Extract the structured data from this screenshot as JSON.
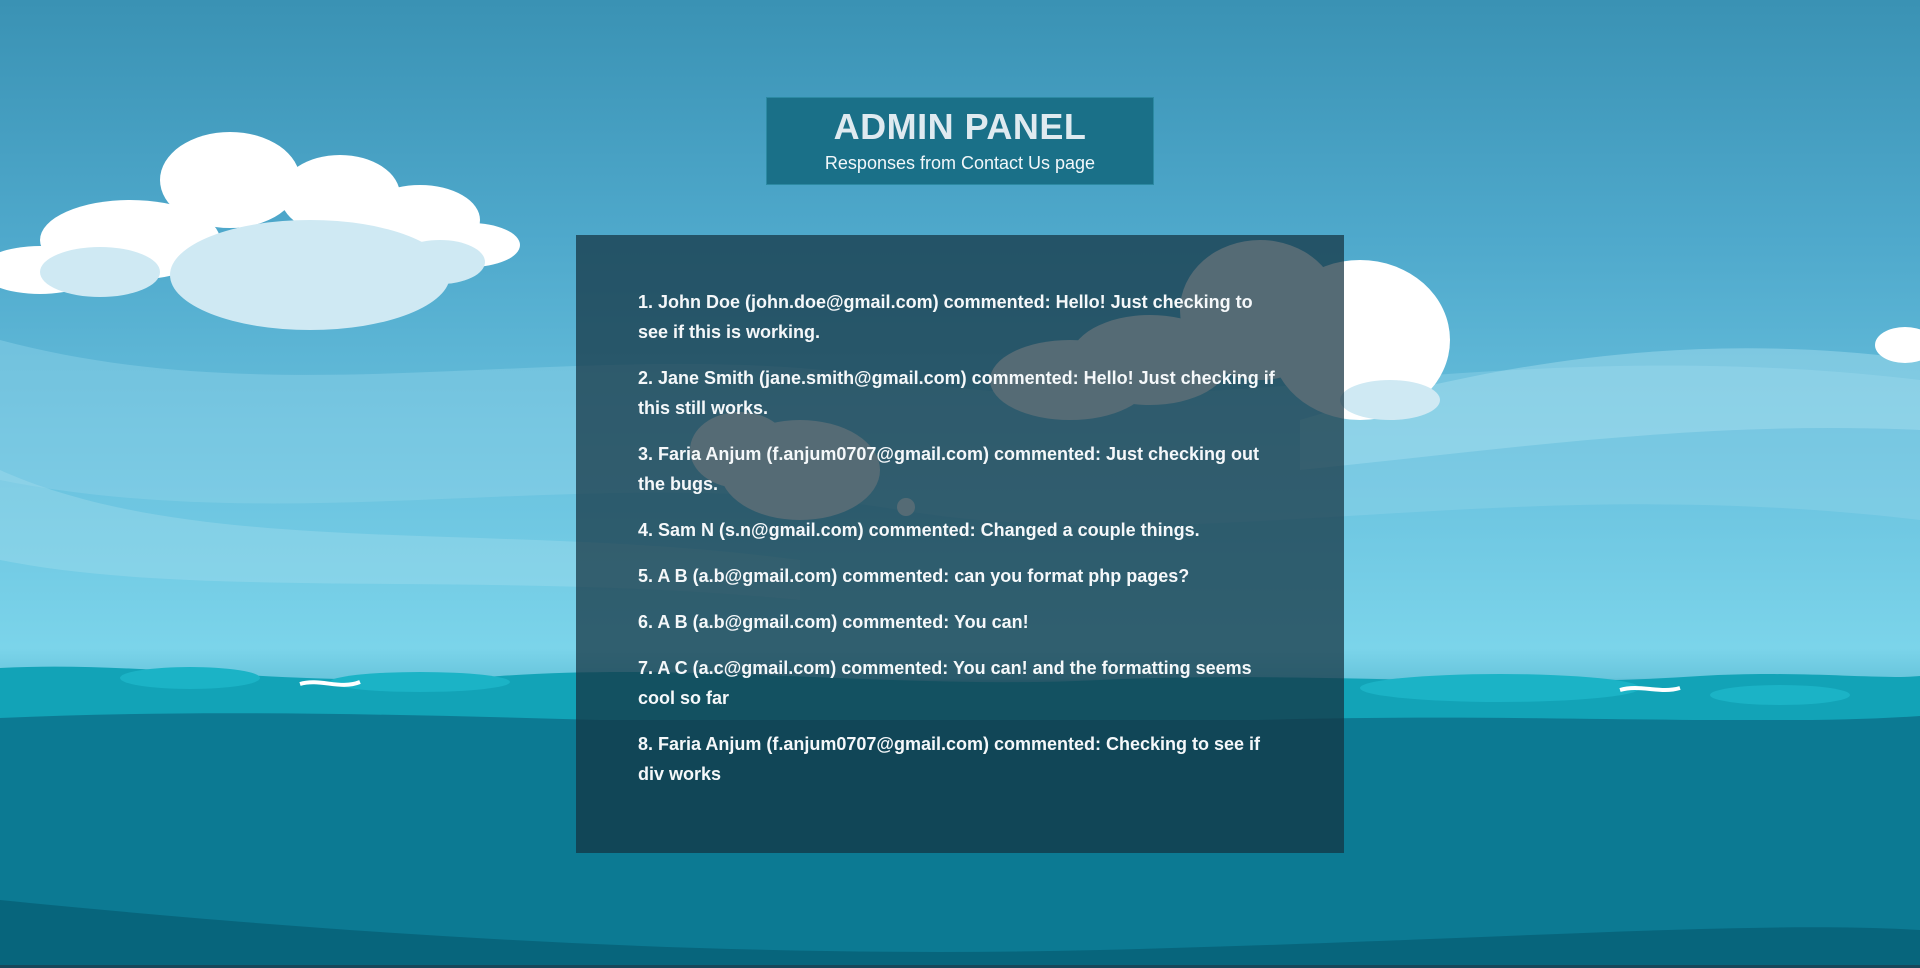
{
  "header": {
    "title": "ADMIN PANEL",
    "subtitle": "Responses from Contact Us page"
  },
  "comments": [
    "1. John Doe (john.doe@gmail.com) commented: Hello! Just checking to see if this is working.",
    "2. Jane Smith (jane.smith@gmail.com) commented: Hello! Just checking if this still works.",
    "3. Faria Anjum (f.anjum0707@gmail.com) commented: Just checking out the bugs.",
    "4. Sam N (s.n@gmail.com) commented: Changed a couple things.",
    "5. A B (a.b@gmail.com) commented: can you format php pages?",
    "6. A B (a.b@gmail.com) commented: You can!",
    "7. A C (a.c@gmail.com) commented: You can! and the formatting seems cool so far",
    "8. Faria Anjum (f.anjum0707@gmail.com) commented: Checking to see if div works"
  ],
  "colors": {
    "sky": "#4fa9cc",
    "sea": "#0a6d86",
    "header_bg": "#1a7088",
    "panel_bg": "#14323f"
  }
}
